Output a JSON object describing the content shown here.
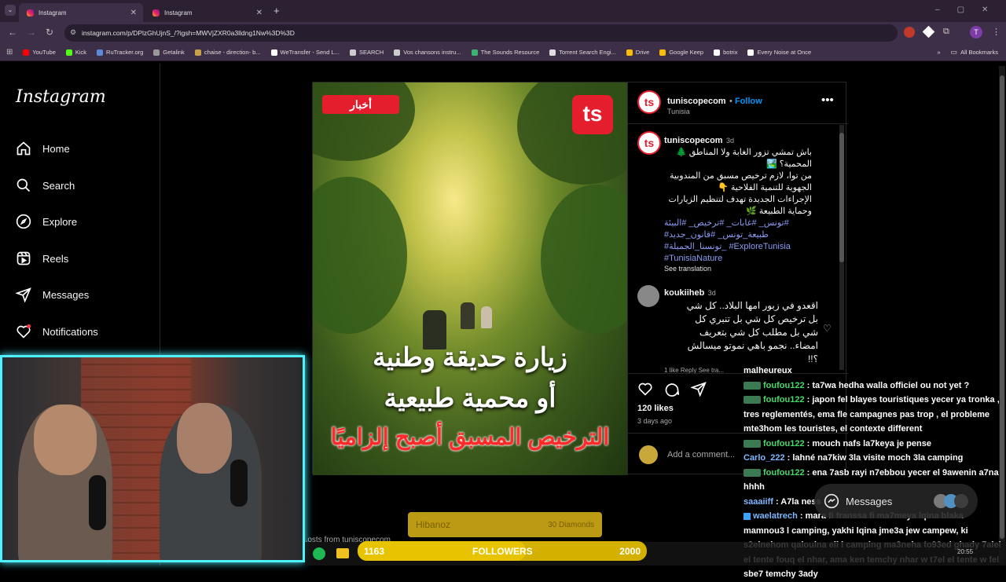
{
  "browser": {
    "tabs": [
      {
        "title": "Instagram"
      },
      {
        "title": "Instagram"
      }
    ],
    "url": "instagram.com/p/DPlzGhUjnS_/?igsh=MWVjZXR0a3lldng1Nw%3D%3D",
    "bookmarks": [
      {
        "label": "YouTube",
        "color": "#ff0000"
      },
      {
        "label": "Kick",
        "color": "#53fc18"
      },
      {
        "label": "RuTracker.org",
        "color": "#5b8bd8"
      },
      {
        "label": "Getalink",
        "color": "#999999"
      },
      {
        "label": "chaise - direction- b...",
        "color": "#c8a04a"
      },
      {
        "label": "WeTransfer - Send L...",
        "color": "#ffffff"
      },
      {
        "label": "SEARCH",
        "color": "#cccccc"
      },
      {
        "label": "Vos chansons instru...",
        "color": "#cccccc"
      },
      {
        "label": "The Sounds Resource",
        "color": "#3cb371"
      },
      {
        "label": "Torrent Search Engi...",
        "color": "#dddddd"
      },
      {
        "label": "Drive",
        "color": "#fbbc04"
      },
      {
        "label": "Google Keep",
        "color": "#fbbc04"
      },
      {
        "label": "botrix",
        "color": "#ffffff"
      },
      {
        "label": "Every Noise at Once",
        "color": "#ffffff"
      }
    ],
    "all_bookmarks": "All Bookmarks"
  },
  "instagram": {
    "logo": "Instagram",
    "nav": [
      {
        "label": "Home",
        "icon": "home-icon"
      },
      {
        "label": "Search",
        "icon": "search-icon"
      },
      {
        "label": "Explore",
        "icon": "compass-icon"
      },
      {
        "label": "Reels",
        "icon": "reels-icon"
      },
      {
        "label": "Messages",
        "icon": "send-icon"
      },
      {
        "label": "Notifications",
        "icon": "heart-icon"
      }
    ],
    "post": {
      "image_badge": "أخبار",
      "image_logo": "ts",
      "image_lines": [
        "زيارة حديقة وطنية",
        "أو محمية طبيعية",
        "الترخيص المسبق أصبح إلزاميًا"
      ],
      "author": "tuniscopecom",
      "follow": "Follow",
      "location": "Tunisia",
      "caption_time": "3d",
      "caption_lines": [
        "باش تمشي تزور الغابة ولا المناطق 🌲",
        "المحمية؟ 🏞️",
        "من توا، لازم ترخيص مسبق من المندوبية",
        "الجهوية للتنمية الفلاحية 👇",
        "الإجراءات الجديدة تهدف لتنظيم الزيارات",
        "وحماية الطبيعة 🌿"
      ],
      "hashtags": [
        "تونس_ #غابات_ #ترخيص_ #البيئة#",
        "#طبيعة_تونس_ #قانون_جديد",
        "#تونسنا_الجميلة_ #ExploreTunisia",
        "#TunisiaNature"
      ],
      "see_translation": "See translation",
      "comment": {
        "user": "koukiiheb",
        "time": "3d",
        "lines": [
          "اقعدو في زبور امها البلاد.. كل شي",
          "بل ترخيص كل شي بل تنبري كل",
          "شي بل مطلب كل شي بتعريف",
          "امضاء.. نجمو باهي نموتو ميسالش",
          "؟!!"
        ],
        "meta": "1 like   Reply   See tra..."
      },
      "likes": "120 likes",
      "posted": "3 days ago",
      "add_comment": "Add a comment..."
    },
    "messages_pill": "Messages",
    "more_posts": "...osts from tuniscopecom"
  },
  "stream": {
    "chat": [
      {
        "user": "",
        "text": "malheureux",
        "badge": ""
      },
      {
        "user": "foufou122",
        "text": " : ta7wa hedha walla officiel ou not yet ?",
        "badge": "g"
      },
      {
        "user": "foufou122",
        "text": " : japon fel blayes touristiques yecer ya tronka , tres reglementés, ema fle campagnes pas trop , el probleme mte3hom les touristes, el contexte different",
        "badge": "g"
      },
      {
        "user": "foufou122",
        "text": " : mouch nafs la7keya je pense",
        "badge": "g"
      },
      {
        "user": "Carlo_222",
        "text": " : lahné na7kiw 3la visite moch 3la camping",
        "badge": ""
      },
      {
        "user": "foufou122",
        "text": " : ena 7asb rayi n7ebbou yecer el 9awenin a7na hhhh",
        "badge": "g"
      },
      {
        "user": "saaaiiff",
        "text": " : A7la ness",
        "badge": ""
      },
      {
        "user": "waelatrech",
        "text": " : mara fi franssa fi ma7meya lqina blaka mamnou3 l camping, yakhi lqina jme3a jew campew, ki s2elnehom qaloulna eli l camping ma3neha to93ed ghady 7alel el tente fouq el nhar, ama ken temchy nhar w t7el el tente w fel sbe7 temchy 3ady",
        "badge": "b"
      }
    ],
    "diamond_user": "Hibanoz",
    "diamond_amount": "30 Diamonds",
    "followers_label": "FOLLOWERS",
    "followers_current": "1163",
    "followers_goal": "2000",
    "clock": "20:55"
  }
}
